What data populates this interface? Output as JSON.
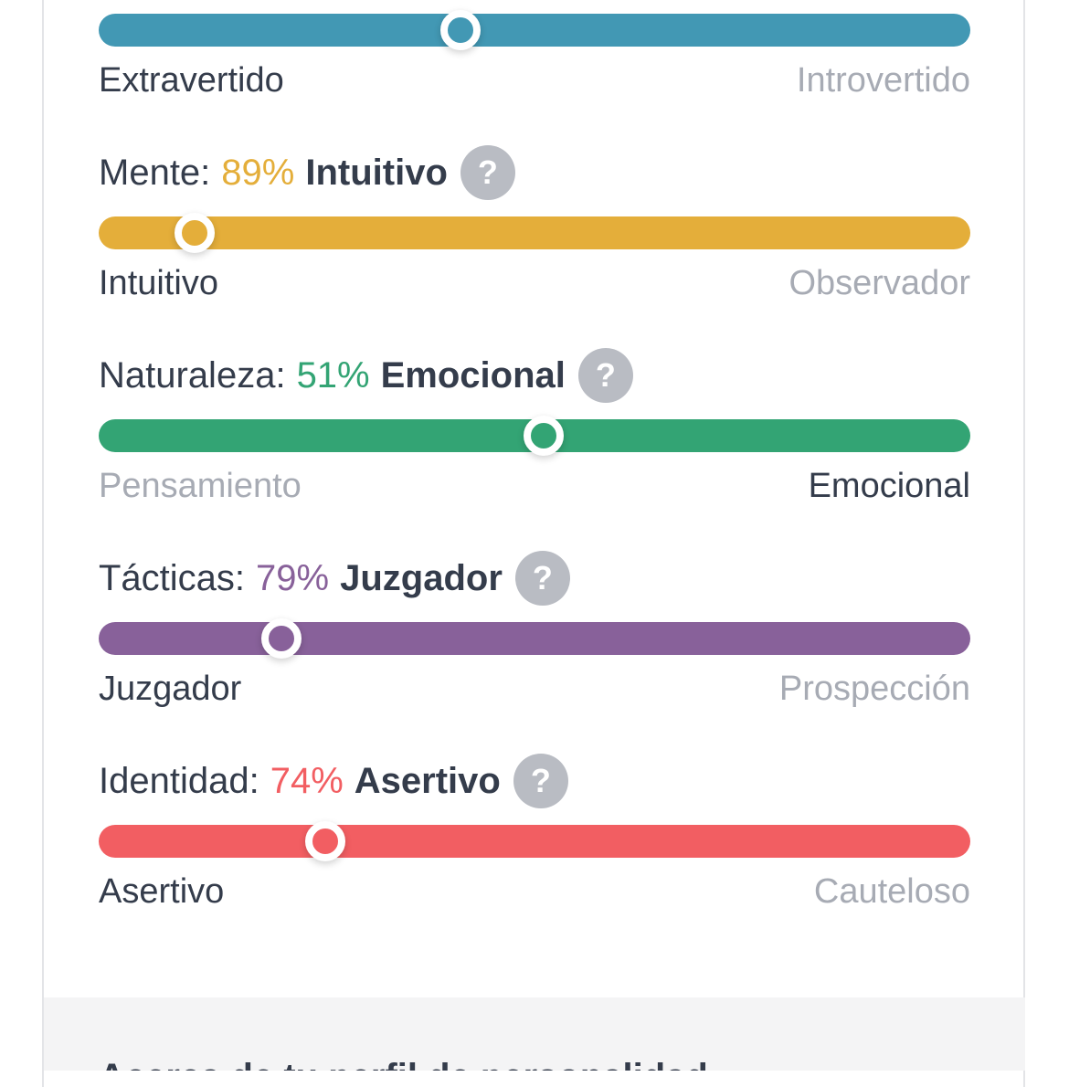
{
  "traits": [
    {
      "id": "energia",
      "left_label": "Extravertido",
      "right_label": "Introvertido",
      "active_side": "left",
      "color": "#4298b4",
      "knob_position_pct": 41.5
    },
    {
      "id": "mente",
      "category": "Mente:",
      "percent": "89%",
      "type": "Intuitivo",
      "left_label": "Intuitivo",
      "right_label": "Observador",
      "active_side": "left",
      "color": "#e4ae3a",
      "knob_position_pct": 11
    },
    {
      "id": "naturaleza",
      "category": "Naturaleza:",
      "percent": "51%",
      "type": "Emocional",
      "left_label": "Pensamiento",
      "right_label": "Emocional",
      "active_side": "right",
      "color": "#33a474",
      "knob_position_pct": 51
    },
    {
      "id": "tacticas",
      "category": "Tácticas:",
      "percent": "79%",
      "type": "Juzgador",
      "left_label": "Juzgador",
      "right_label": "Prospección",
      "active_side": "left",
      "color": "#88619a",
      "knob_position_pct": 21
    },
    {
      "id": "identidad",
      "category": "Identidad:",
      "percent": "74%",
      "type": "Asertivo",
      "left_label": "Asertivo",
      "right_label": "Cauteloso",
      "active_side": "left",
      "color": "#f25e62",
      "knob_position_pct": 26
    }
  ],
  "help_icon": "question-mark-icon",
  "help_glyph": "?",
  "footer": {
    "partial_text": "Acerca de tu perfil de personalidad"
  }
}
